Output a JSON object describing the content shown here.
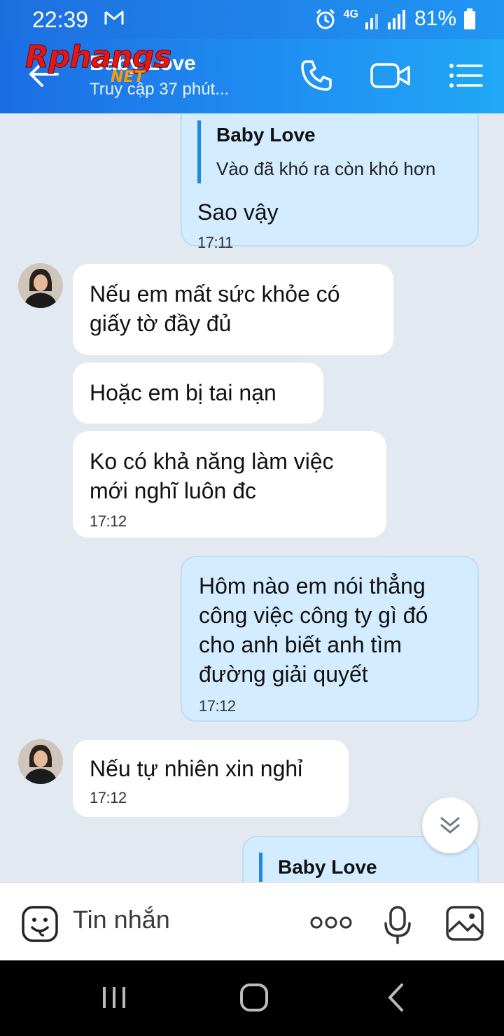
{
  "status_bar": {
    "time": "22:39",
    "network": "4G",
    "battery": "81%"
  },
  "header": {
    "title": "Baby Love",
    "subtitle": "Truy cập 37 phút...",
    "watermark": "Rphangs",
    "watermark_suffix": "NET"
  },
  "messages": [
    {
      "quote_name": "Baby Love",
      "quote_text": "Vào đã khó ra còn khó hơn",
      "text": "Sao vậy",
      "time": "17:11"
    },
    {
      "text_line1": "Nếu em mất sức khỏe có",
      "text_line2": "giấy tờ đầy đủ"
    },
    {
      "text": "Hoặc em bị tai nạn"
    },
    {
      "text_line1": "Ko có khả năng làm việc",
      "text_line2": "mới nghĩ luôn đc",
      "time": "17:12"
    },
    {
      "text_line1": "Hôm nào em nói thẳng",
      "text_line2": "công việc công ty gì đó",
      "text_line3": "cho anh biết anh tìm",
      "text_line4": "đường giải quyết",
      "time": "17:12"
    },
    {
      "text": "Nếu tự nhiên xin nghỉ",
      "time": "17:12"
    },
    {
      "quote_name": "Baby Love"
    }
  ],
  "composer": {
    "placeholder": "Tin nhắn"
  },
  "icons": [
    "back-arrow-icon",
    "phone-icon",
    "video-call-icon",
    "menu-list-icon",
    "sticker-icon",
    "more-icon",
    "microphone-icon",
    "image-icon",
    "scroll-down-icon"
  ],
  "colors": {
    "header_start": "#1c6de4",
    "header_end": "#20a8f5",
    "outgoing_bubble": "#d3ecff",
    "incoming_bubble": "#ffffff",
    "chat_bg": "#e2e9f1",
    "quote_bar": "#1e88e5"
  }
}
